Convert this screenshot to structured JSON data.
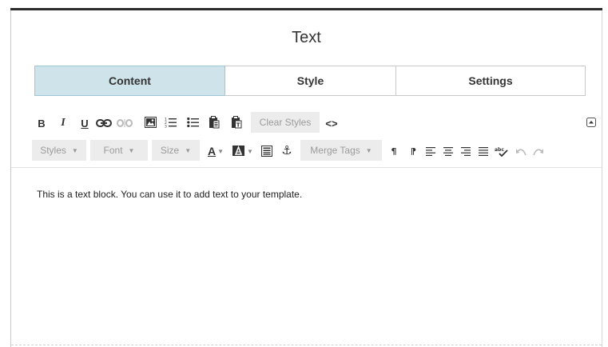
{
  "panel": {
    "title": "Text"
  },
  "tabs": [
    {
      "label": "Content",
      "active": true
    },
    {
      "label": "Style",
      "active": false
    },
    {
      "label": "Settings",
      "active": false
    }
  ],
  "toolbar": {
    "bold": "B",
    "italic": "I",
    "underline": "U",
    "clear_styles": "Clear Styles",
    "source_code": "<>",
    "styles_dropdown": "Styles",
    "font_dropdown": "Font",
    "size_dropdown": "Size",
    "text_color": "A",
    "merge_tags": "Merge Tags"
  },
  "editor": {
    "content": "This is a text block. You can use it to add text to your template."
  },
  "colors": {
    "active_tab": "#cfe3ea",
    "active_tab_border": "#9ec6d4",
    "toolbar_button_bg": "#ececec"
  }
}
